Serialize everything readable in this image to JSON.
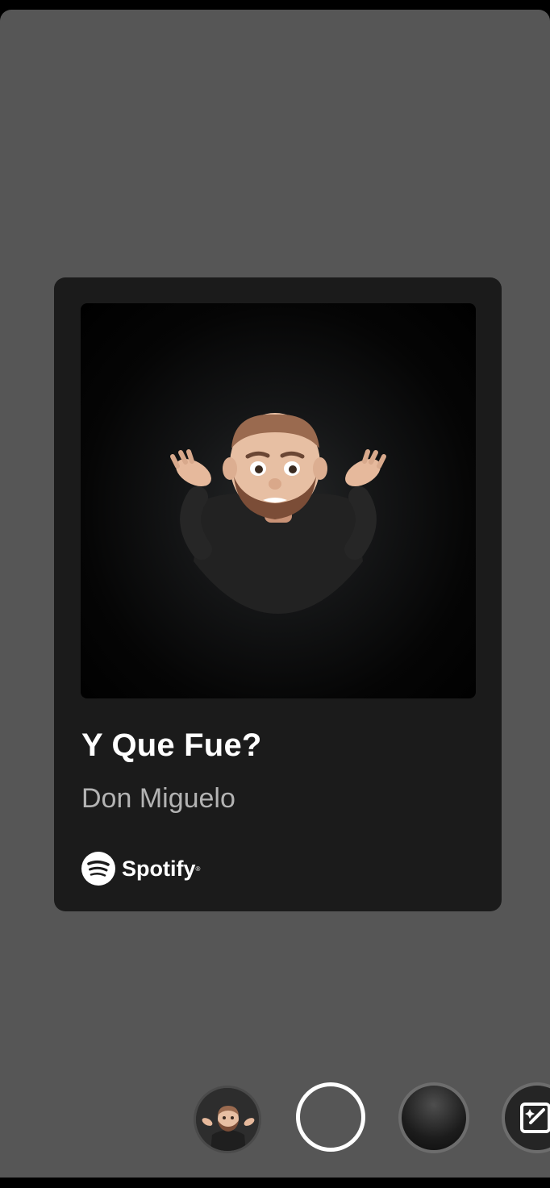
{
  "track": {
    "title": "Y Que Fue?",
    "artist": "Don Miguelo",
    "cover_icon": "memoji-shrug-artwork"
  },
  "brand": {
    "name": "Spotify",
    "registered": "®",
    "icon": "spotify-logo-icon",
    "color": "#ffffff"
  },
  "controls": {
    "thumbnail_icon": "memoji-thumbnail",
    "shutter_icon": "capture-button",
    "background_icon": "dark-background-option",
    "edit_icon": "sparkle-edit-icon"
  },
  "colors": {
    "stage": "#565656",
    "card": "#1b1b1b",
    "title": "#ffffff",
    "artist": "#b3b3b3"
  }
}
